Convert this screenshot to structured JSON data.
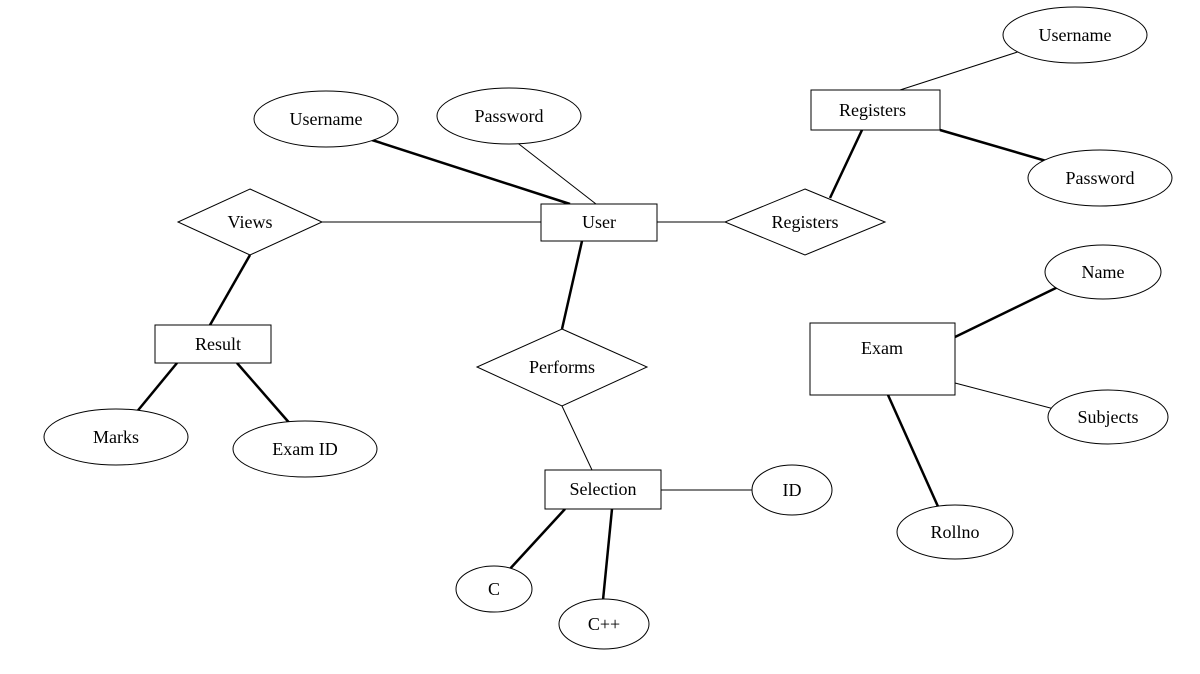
{
  "entities": {
    "user": "User",
    "result": "Result",
    "registers_entity": "Registers",
    "exam": "Exam",
    "selection": "Selection"
  },
  "relationships": {
    "views": "Views",
    "performs": "Performs",
    "registers_rel": "Registers"
  },
  "attributes": {
    "user_username": "Username",
    "user_password": "Password",
    "reg_username": "Username",
    "reg_password": "Password",
    "result_marks": "Marks",
    "result_examid": "Exam ID",
    "exam_name": "Name",
    "exam_subjects": "Subjects",
    "exam_rollno": "Rollno",
    "selection_id": "ID",
    "selection_c": "C",
    "selection_cpp": "C++"
  },
  "diagram": {
    "type": "ER",
    "entities": [
      {
        "id": "user",
        "attributes": [
          "user_username",
          "user_password"
        ]
      },
      {
        "id": "result",
        "attributes": [
          "result_marks",
          "result_examid"
        ]
      },
      {
        "id": "registers_entity",
        "attributes": [
          "reg_username",
          "reg_password"
        ]
      },
      {
        "id": "exam",
        "attributes": [
          "exam_name",
          "exam_subjects",
          "exam_rollno"
        ]
      },
      {
        "id": "selection",
        "attributes": [
          "selection_id",
          "selection_c",
          "selection_cpp"
        ]
      }
    ],
    "relationships": [
      {
        "id": "views",
        "between": [
          "user",
          "result"
        ]
      },
      {
        "id": "performs",
        "between": [
          "user",
          "selection"
        ]
      },
      {
        "id": "registers_rel",
        "between": [
          "user",
          "registers_entity"
        ]
      }
    ]
  }
}
